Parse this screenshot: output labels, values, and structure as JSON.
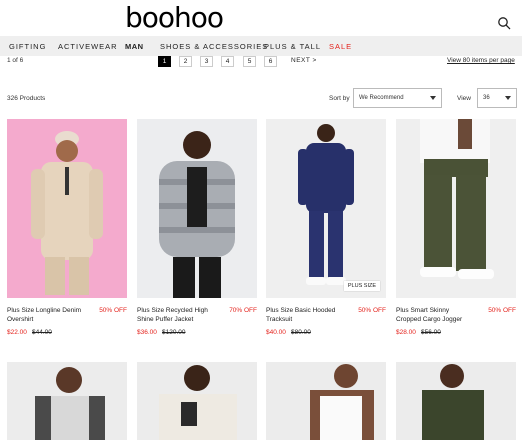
{
  "brand": {
    "logo_text": "boohoo"
  },
  "nav": {
    "items": [
      {
        "label": "GIFTING"
      },
      {
        "label": "ACTIVEWEAR"
      },
      {
        "label": "MAN"
      },
      {
        "label": "SHOES & ACCESSORIES"
      },
      {
        "label": "PLUS & TALL"
      },
      {
        "label": "SALE"
      }
    ]
  },
  "pagination": {
    "summary": "1 of 6",
    "pages": [
      "1",
      "2",
      "3",
      "4",
      "5",
      "6"
    ],
    "current": "1",
    "next_label": "NEXT >",
    "view_more": "View 80 items per page"
  },
  "listing": {
    "count_text": "326 Products",
    "sort_label": "Sort by",
    "sort_value": "We Recommend",
    "view_label": "View",
    "view_value": "36"
  },
  "products": [
    {
      "name": "Plus Size Longline Denim Overshirt",
      "discount": "50% OFF",
      "price": "$22.00",
      "was": "$44.00",
      "badge": ""
    },
    {
      "name": "Plus Size Recycled High Shine Puffer Jacket",
      "discount": "70% OFF",
      "price": "$36.00",
      "was": "$120.00",
      "badge": ""
    },
    {
      "name": "Plus Size Basic Hooded Tracksuit",
      "discount": "50% OFF",
      "price": "$40.00",
      "was": "$80.00",
      "badge": "PLUS SIZE"
    },
    {
      "name": "Plus Smart Skinny Cropped Cargo Jogger",
      "discount": "50% OFF",
      "price": "$28.00",
      "was": "$56.00",
      "badge": ""
    }
  ],
  "colors": {
    "accent_red": "#e4231d",
    "nav_bg": "#efefef"
  }
}
